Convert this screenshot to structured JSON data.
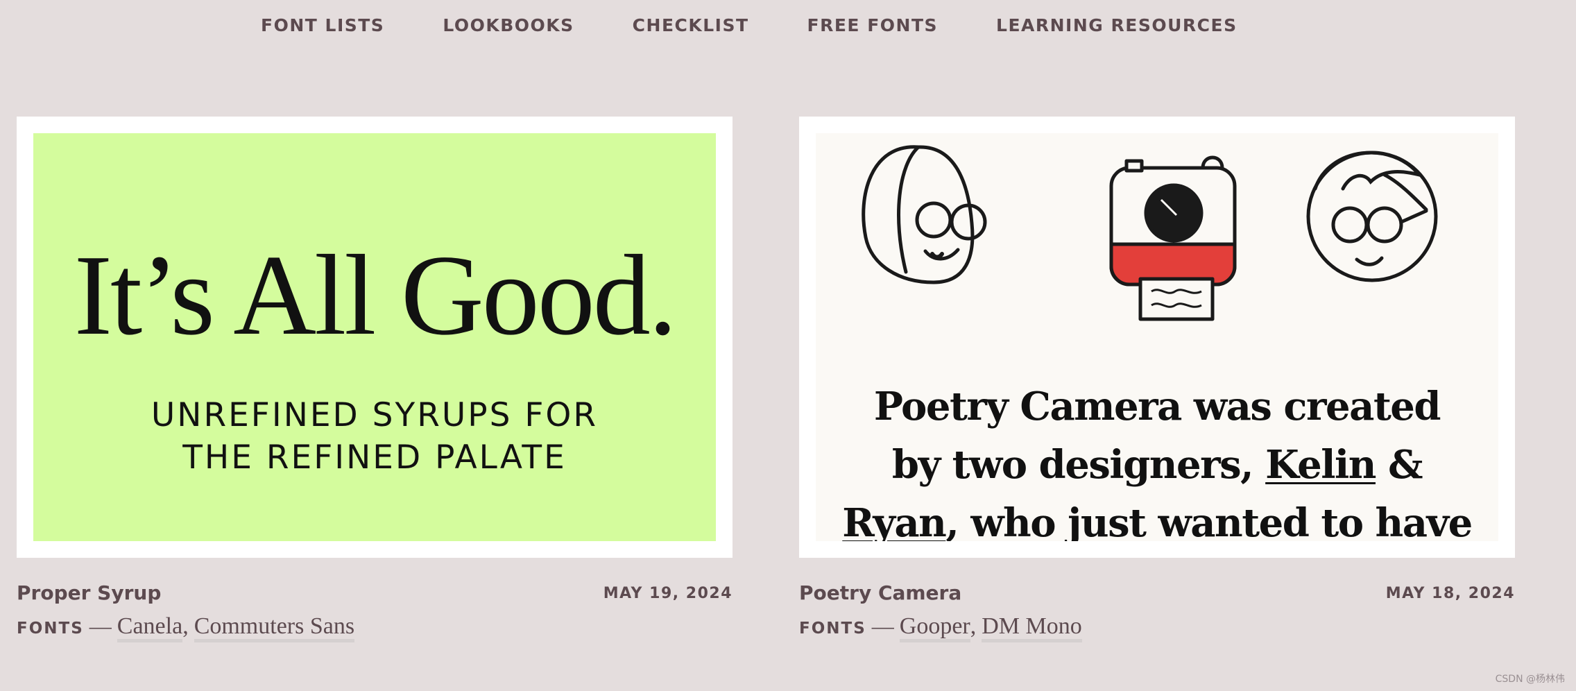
{
  "nav": {
    "items": [
      {
        "label": "FONT LISTS"
      },
      {
        "label": "LOOKBOOKS"
      },
      {
        "label": "CHECKLIST"
      },
      {
        "label": "FREE FONTS"
      },
      {
        "label": "LEARNING RESOURCES"
      }
    ]
  },
  "posts": [
    {
      "image": {
        "headline": "It’s All Good.",
        "subline": "UNREFINED SYRUPS FOR\nTHE REFINED PALATE",
        "background": "#d4fc9d"
      },
      "title": "Proper Syrup",
      "date": "MAY 19, 2024",
      "fonts_label": "FONTS",
      "dash": "—",
      "fonts": [
        "Canela",
        "Commuters Sans"
      ]
    },
    {
      "image": {
        "line1": "Poetry Camera was created",
        "line2_pre": "by two designers, ",
        "line2_link": "Kelin",
        "line2_post": " &",
        "line3_link": "Ryan",
        "line3_post": ", who just wanted to have",
        "background": "#fbf9f5",
        "accent": "#e33f3a",
        "icons": [
          "girl-face-icon",
          "poetry-camera-icon",
          "boy-face-icon"
        ]
      },
      "title": "Poetry Camera",
      "date": "MAY 18, 2024",
      "fonts_label": "FONTS",
      "dash": "—",
      "fonts": [
        "Gooper",
        "DM Mono"
      ]
    }
  ],
  "credit": "CSDN @杨林伟"
}
